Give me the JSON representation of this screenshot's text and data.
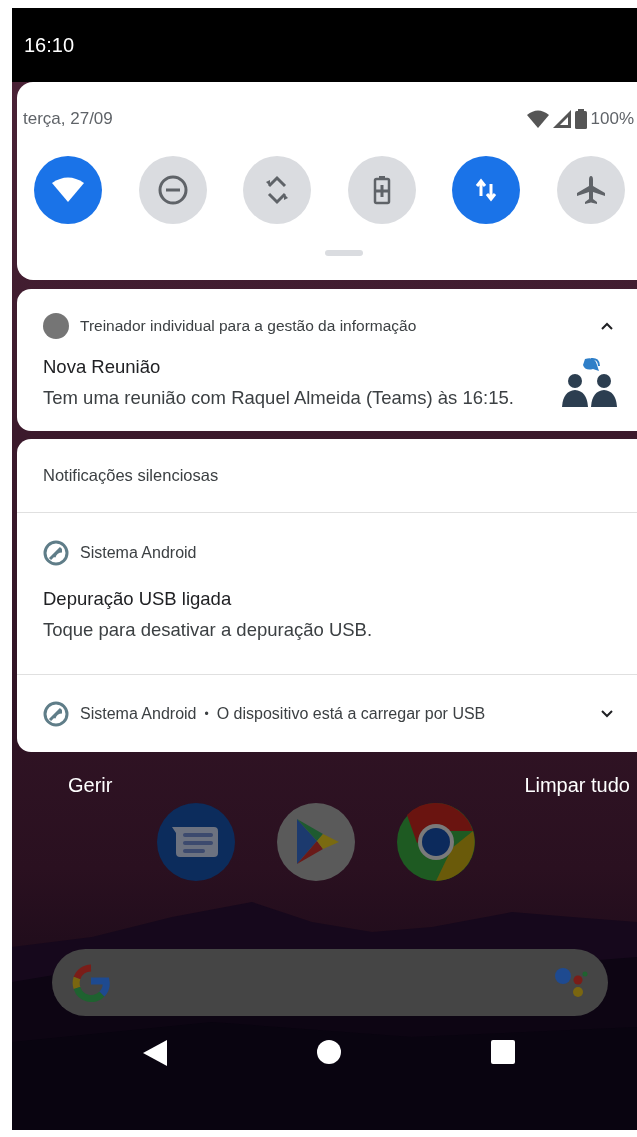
{
  "status_bar": {
    "time": "16:10"
  },
  "quick_settings": {
    "date": "terça, 27/09",
    "battery": "100%",
    "tiles": [
      {
        "kind": "wifi",
        "on": true
      },
      {
        "kind": "dnd",
        "on": false
      },
      {
        "kind": "rotate",
        "on": false
      },
      {
        "kind": "battery_saver",
        "on": false
      },
      {
        "kind": "mobile_data",
        "on": true
      },
      {
        "kind": "airplane",
        "on": false
      }
    ]
  },
  "notifications": [
    {
      "app": "Treinador individual para a gestão da informação",
      "expanded": true,
      "title": "Nova Reunião",
      "text": "Tem uma reunião com Raquel Almeida (Teams) às 16:15."
    }
  ],
  "silent": {
    "header": "Notificações silenciosas",
    "items": [
      {
        "app": "Sistema Android",
        "expanded": true,
        "title": "Depuração USB ligada",
        "text": "Toque para desativar a depuração USB."
      },
      {
        "app": "Sistema Android",
        "expanded": false,
        "separator": "•",
        "summary": "O dispositivo está a carregar por USB"
      }
    ]
  },
  "actions": [
    "Gerir",
    "Limpar tudo"
  ]
}
